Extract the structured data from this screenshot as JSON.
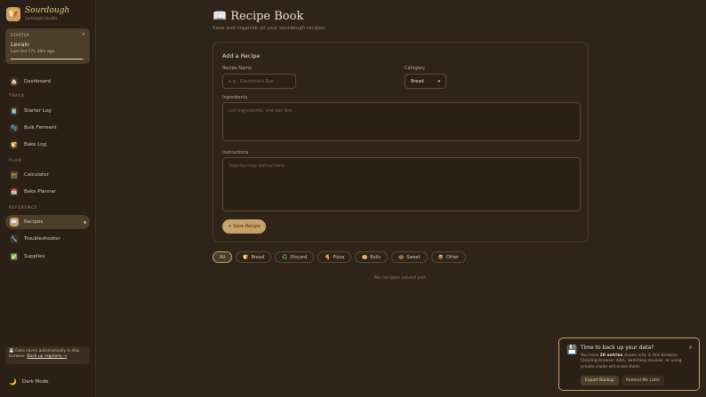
{
  "brand": {
    "name": "Sourdough",
    "subtitle": "cortexpill.studio",
    "icon": "bread-icon"
  },
  "starter": {
    "label": "STARTER",
    "name": "Levain",
    "last_fed": "Last fed 17h 39m ago",
    "progress": 0.98
  },
  "sidebar": {
    "sections": {
      "track": "TRACK",
      "plan": "PLAN",
      "reference": "REFERENCE"
    },
    "items": {
      "dashboard": {
        "label": "Dashboard",
        "icon": "🏠"
      },
      "starter_log": {
        "label": "Starter Log",
        "icon": "🫙"
      },
      "bulk_ferment": {
        "label": "Bulk Ferment",
        "icon": "🫧"
      },
      "bake_log": {
        "label": "Bake Log",
        "icon": "🍞"
      },
      "calculator": {
        "label": "Calculator",
        "icon": "🧮"
      },
      "bake_planner": {
        "label": "Bake Planner",
        "icon": "📅"
      },
      "recipes": {
        "label": "Recipes",
        "icon": "📖"
      },
      "troubleshooter": {
        "label": "Troubleshooter",
        "icon": "🔧"
      },
      "supplies": {
        "label": "Supplies",
        "icon": "✅"
      }
    },
    "save_note": "💾 Data saves automatically in this browser.",
    "save_note_link": "Back up regularly →",
    "dark_mode": {
      "label": "Dark Mode",
      "icon": "🌙"
    }
  },
  "page": {
    "title": "Recipe Book",
    "title_icon": "📖",
    "subtitle": "Save and organize all your sourdough recipes."
  },
  "form": {
    "title": "Add a Recipe",
    "name_label": "Recipe Name",
    "name_placeholder": "e.g., Grandma's Rye",
    "category_label": "Category",
    "category_value": "Bread",
    "ingredients_label": "Ingredients",
    "ingredients_placeholder": "List ingredients, one per line...",
    "instructions_label": "Instructions",
    "instructions_placeholder": "Step-by-step instructions...",
    "save_label": "+ Save Recipe"
  },
  "filters": [
    {
      "label": "All",
      "icon": ""
    },
    {
      "label": "Bread",
      "icon": "🍞"
    },
    {
      "label": "Discard",
      "icon": "♻️"
    },
    {
      "label": "Pizza",
      "icon": "🍕"
    },
    {
      "label": "Rolls",
      "icon": "🥯"
    },
    {
      "label": "Sweet",
      "icon": "🍩"
    },
    {
      "label": "Other",
      "icon": "📦"
    }
  ],
  "empty_state": "No recipes saved yet.",
  "toast": {
    "icon": "💾",
    "title": "Time to back up your data?",
    "msg_pre": "You have ",
    "msg_count": "20 entries",
    "msg_post": " stored only in this browser. Clearing browser data, switching devices, or using private mode will erase them.",
    "primary": "Export Backup",
    "secondary": "Remind Me Later",
    "close": "×"
  }
}
